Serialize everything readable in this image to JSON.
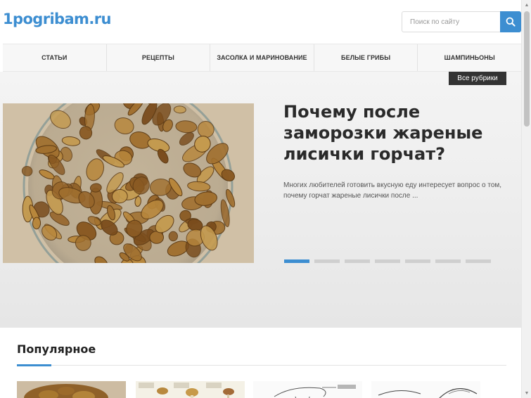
{
  "site": {
    "logo": "1pogribam.ru",
    "search_placeholder": "Поиск по сайту"
  },
  "icons": {
    "search": "search-icon",
    "scroll_up": "arrow-up-icon",
    "scroll_down": "arrow-down-icon"
  },
  "nav": {
    "items": [
      {
        "label": "СТАТЬИ"
      },
      {
        "label": "РЕЦЕПТЫ"
      },
      {
        "label": "ЗАСОЛКА И МАРИНОВАНИЕ"
      },
      {
        "label": "БЕЛЫЕ ГРИБЫ"
      },
      {
        "label": "ШАМПИНЬОНЫ"
      }
    ]
  },
  "hero": {
    "all_categories": "Все рубрики",
    "title": "Почему после заморозки жареные лисички горчат?",
    "excerpt": "Многих любителей готовить вкусную еду интересует вопрос о том, почему горчат жареные лисички после ...",
    "slides_count": 7,
    "active_slide": 1
  },
  "popular": {
    "heading": "Популярное"
  },
  "colors": {
    "accent": "#3d8ed1",
    "dark_badge": "#333333",
    "hero_bg": "#ececec"
  }
}
